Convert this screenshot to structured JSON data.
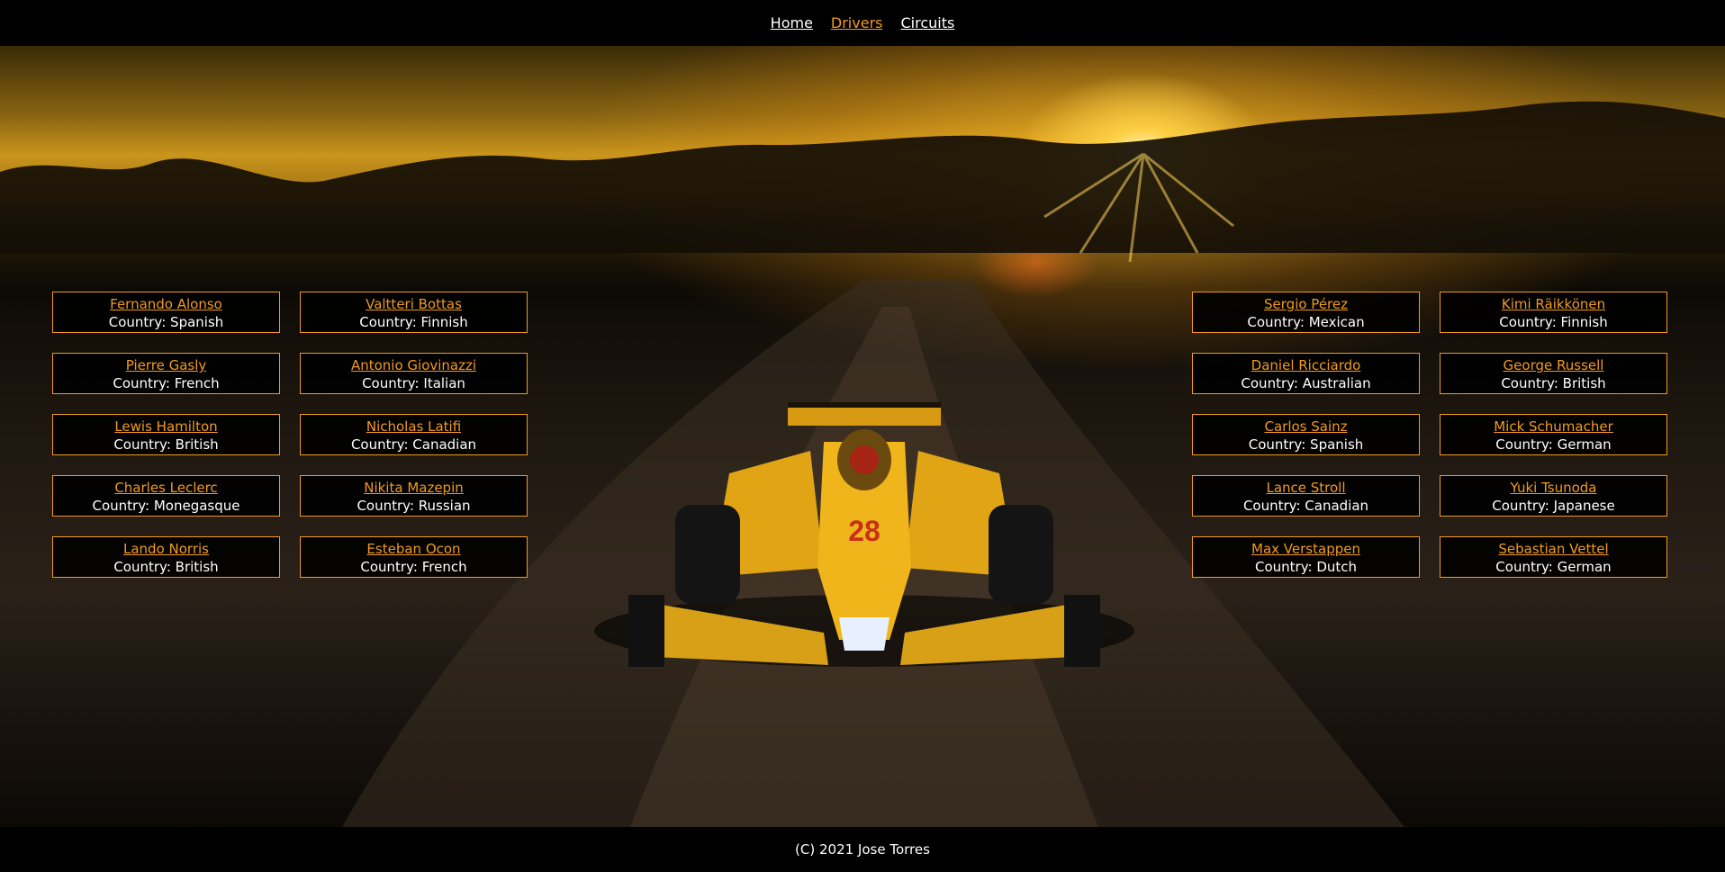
{
  "nav": {
    "items": [
      {
        "label": "Home",
        "active": false
      },
      {
        "label": "Drivers",
        "active": true
      },
      {
        "label": "Circuits",
        "active": false
      }
    ]
  },
  "country_prefix": "Country: ",
  "drivers": {
    "left": [
      [
        {
          "name": "Fernando Alonso",
          "country": "Spanish"
        },
        {
          "name": "Valtteri Bottas",
          "country": "Finnish"
        }
      ],
      [
        {
          "name": "Pierre Gasly",
          "country": "French"
        },
        {
          "name": "Antonio Giovinazzi",
          "country": "Italian"
        }
      ],
      [
        {
          "name": "Lewis Hamilton",
          "country": "British"
        },
        {
          "name": "Nicholas Latifi",
          "country": "Canadian"
        }
      ],
      [
        {
          "name": "Charles Leclerc",
          "country": "Monegasque"
        },
        {
          "name": "Nikita Mazepin",
          "country": "Russian"
        }
      ],
      [
        {
          "name": "Lando Norris",
          "country": "British"
        },
        {
          "name": "Esteban Ocon",
          "country": "French"
        }
      ]
    ],
    "right": [
      [
        {
          "name": "Sergio Pérez",
          "country": "Mexican"
        },
        {
          "name": "Kimi Räikkönen",
          "country": "Finnish"
        }
      ],
      [
        {
          "name": "Daniel Ricciardo",
          "country": "Australian"
        },
        {
          "name": "George Russell",
          "country": "British"
        }
      ],
      [
        {
          "name": "Carlos Sainz",
          "country": "Spanish"
        },
        {
          "name": "Mick Schumacher",
          "country": "German"
        }
      ],
      [
        {
          "name": "Lance Stroll",
          "country": "Canadian"
        },
        {
          "name": "Yuki Tsunoda",
          "country": "Japanese"
        }
      ],
      [
        {
          "name": "Max Verstappen",
          "country": "Dutch"
        },
        {
          "name": "Sebastian Vettel",
          "country": "German"
        }
      ]
    ]
  },
  "footer": {
    "text": "(C) 2021 Jose Torres"
  },
  "colors": {
    "accent": "#f29a1d",
    "background": "#000000",
    "text": "#ffffff"
  }
}
